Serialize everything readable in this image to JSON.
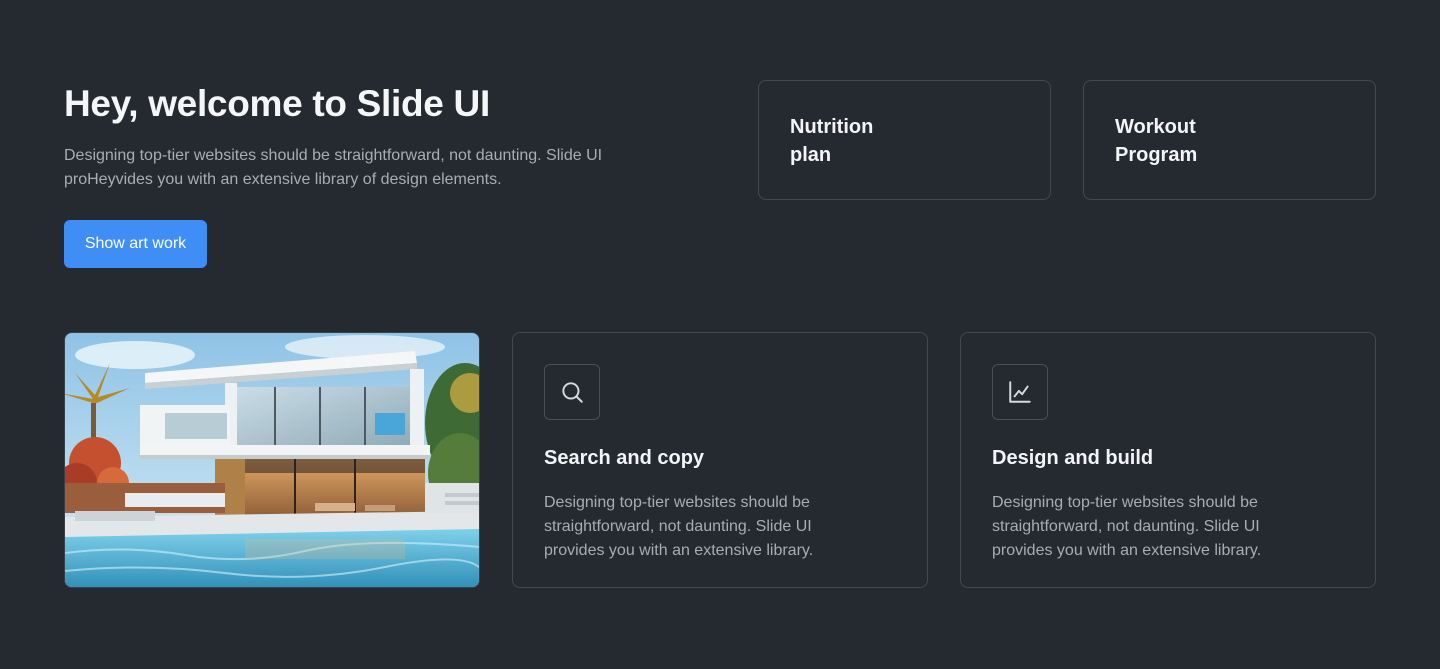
{
  "hero": {
    "title": "Hey, welcome to Slide UI",
    "description": "Designing top-tier websites should be straightforward, not daunting. Slide UI proHeyvides you with an extensive library of design elements.",
    "cta_label": "Show art work"
  },
  "quick_cards": [
    {
      "label": "Nutrition\nplan"
    },
    {
      "label": "Workout\nProgram"
    }
  ],
  "features": [
    {
      "icon": "search-icon",
      "title": "Search and copy",
      "description": "Designing top-tier websites should be straightforward, not daunting. Slide UI provides you with an extensive library."
    },
    {
      "icon": "chart-line-icon",
      "title": "Design and build",
      "description": "Designing top-tier websites should be straightforward, not daunting. Slide UI provides you with an extensive library."
    }
  ],
  "colors": {
    "background": "#252a31",
    "accent": "#3f8ef5",
    "border": "#434951",
    "muted_text": "#a7adb5"
  }
}
